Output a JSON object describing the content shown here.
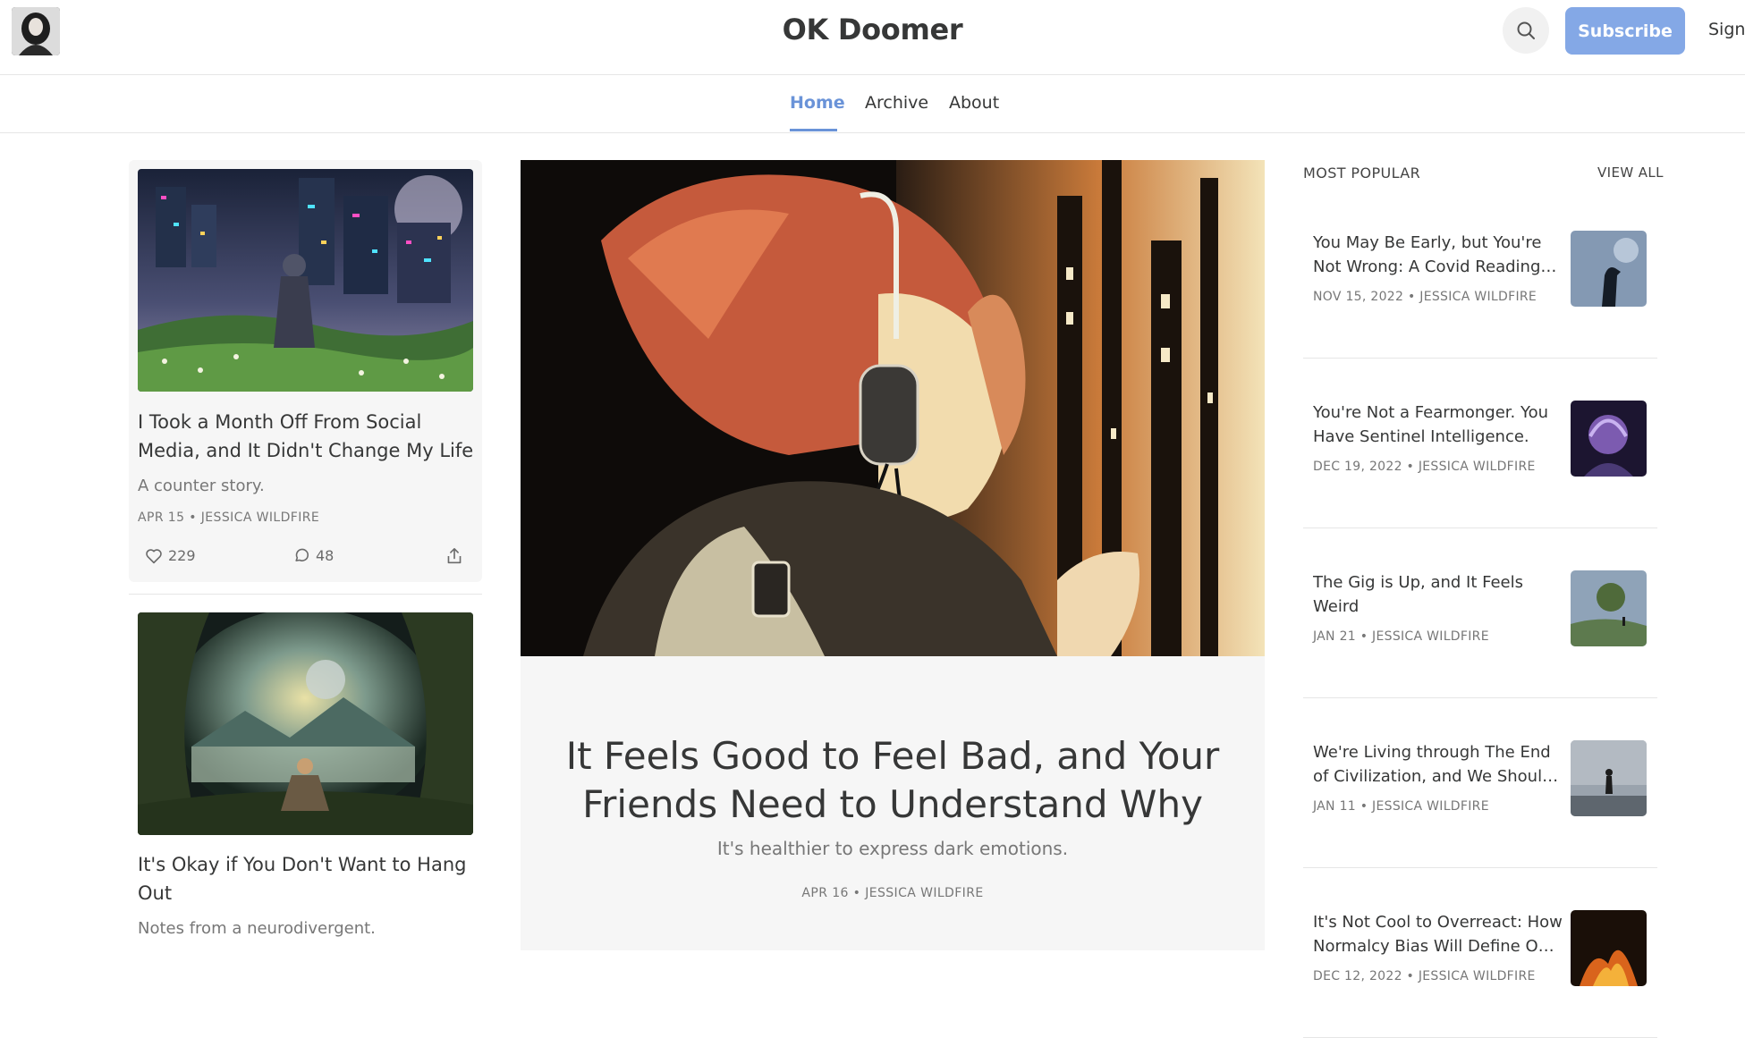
{
  "header": {
    "site_title": "OK Doomer",
    "subscribe_label": "Subscribe",
    "signin_label": "Sign",
    "search_icon": "search-icon",
    "accent_color": "#84a8e6"
  },
  "nav": {
    "tabs": [
      {
        "label": "Home",
        "active": true
      },
      {
        "label": "Archive",
        "active": false
      },
      {
        "label": "About",
        "active": false
      }
    ]
  },
  "left_posts": [
    {
      "title": "I Took a Month Off From Social Media, and It Didn't Change My Life",
      "subtitle": "A counter story.",
      "meta": "APR 15 • JESSICA WILDFIRE",
      "likes": "229",
      "comments": "48"
    },
    {
      "title": "It's Okay if You Don't Want to Hang Out",
      "subtitle": "Notes from a neurodivergent."
    }
  ],
  "featured": {
    "title": "It Feels Good to Feel Bad, and Your Friends Need to Understand Why",
    "subtitle": "It's healthier to express dark emotions.",
    "meta": "APR 16 • JESSICA WILDFIRE"
  },
  "most_popular": {
    "heading": "MOST POPULAR",
    "view_all": "VIEW ALL",
    "items": [
      {
        "title": "You May Be Early, but You're Not Wrong: A Covid Reading List",
        "meta": "NOV 15, 2022 • JESSICA WILDFIRE"
      },
      {
        "title": "You're Not a Fearmonger. You Have Sentinel Intelligence.",
        "meta": "DEC 19, 2022 • JESSICA WILDFIRE"
      },
      {
        "title": "The Gig is Up, and It Feels Weird",
        "meta": "JAN 21 • JESSICA WILDFIRE"
      },
      {
        "title": "We're Living through The End of Civilization, and We Should Talk About It",
        "meta": "JAN 11 • JESSICA WILDFIRE"
      },
      {
        "title": "It's Not Cool to Overreact: How Normalcy Bias Will Define Our Future",
        "meta": "DEC 12, 2022 • JESSICA WILDFIRE"
      }
    ]
  }
}
